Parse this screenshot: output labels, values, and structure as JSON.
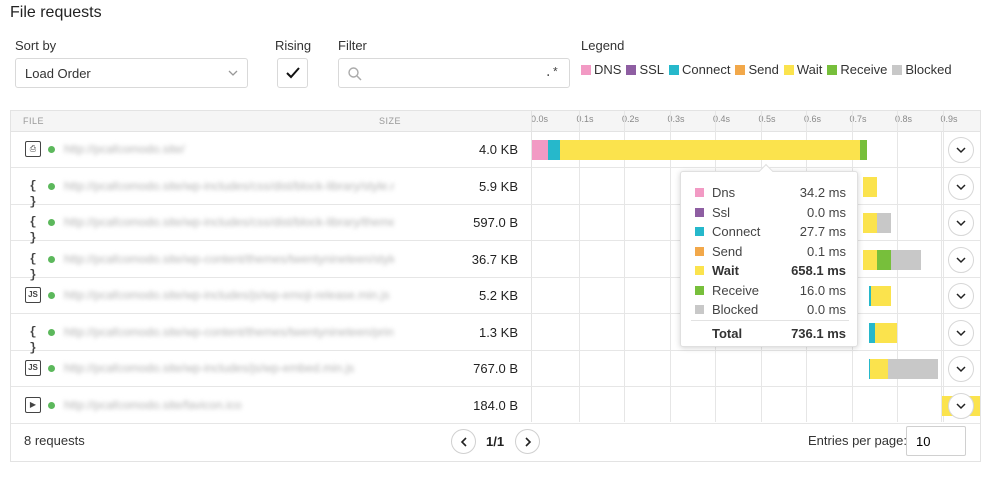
{
  "page": {
    "title": "File requests"
  },
  "controls": {
    "sort_label": "Sort by",
    "sort_value": "Load Order",
    "rising_label": "Rising",
    "filter_label": "Filter",
    "filter_value": "",
    "regex_toggle": ".*",
    "legend_label": "Legend"
  },
  "legend": [
    {
      "name": "DNS",
      "color": "#f29ac4"
    },
    {
      "name": "SSL",
      "color": "#8e5ea2"
    },
    {
      "name": "Connect",
      "color": "#26b8cb"
    },
    {
      "name": "Send",
      "color": "#f2a84a"
    },
    {
      "name": "Wait",
      "color": "#fbe34d"
    },
    {
      "name": "Receive",
      "color": "#77bf3b"
    },
    {
      "name": "Blocked",
      "color": "#c8c8c8"
    }
  ],
  "table": {
    "col_file": "FILE",
    "col_size": "SIZE",
    "ticks": [
      "0.0s",
      "0.1s",
      "0.2s",
      "0.3s",
      "0.4s",
      "0.5s",
      "0.6s",
      "0.7s",
      "0.8s",
      "0.9s"
    ],
    "rows": [
      {
        "icon": "html-file-icon",
        "icon_glyph": "⎙",
        "url": "http://pcafcomodo.site/",
        "size": "4.0 KB",
        "timings": {
          "start": 0.0,
          "dns": 0.0342,
          "ssl": 0.0,
          "connect": 0.0277,
          "send": 0.0001,
          "wait": 0.6581,
          "receive": 0.016,
          "blocked": 0.0
        }
      },
      {
        "icon": "css-file-icon",
        "icon_glyph": "{ }",
        "url": "http://pcafcomodo.site/wp-includes/css/dist/block-library/style.min.css",
        "size": "5.9 KB",
        "timings": {
          "start": 0.728,
          "dns": 0,
          "ssl": 0,
          "connect": 0,
          "send": 0,
          "wait": 0.03,
          "receive": 0,
          "blocked": 0
        }
      },
      {
        "icon": "css-file-icon",
        "icon_glyph": "{ }",
        "url": "http://pcafcomodo.site/wp-includes/css/dist/block-library/theme.min.css",
        "size": "597.0 B",
        "timings": {
          "start": 0.728,
          "dns": 0,
          "ssl": 0,
          "connect": 0,
          "send": 0,
          "wait": 0.03,
          "receive": 0,
          "blocked": 0.032
        }
      },
      {
        "icon": "css-file-icon",
        "icon_glyph": "{ }",
        "url": "http://pcafcomodo.site/wp-content/themes/twentynineteen/style.css",
        "size": "36.7 KB",
        "timings": {
          "start": 0.728,
          "dns": 0,
          "ssl": 0,
          "connect": 0,
          "send": 0,
          "wait": 0.03,
          "receive": 0.032,
          "blocked": 0.066
        }
      },
      {
        "icon": "js-file-icon",
        "icon_glyph": "JS",
        "url": "http://pcafcomodo.site/wp-includes/js/wp-emoji-release.min.js",
        "size": "5.2 KB",
        "timings": {
          "start": 0.74,
          "dns": 0,
          "ssl": 0,
          "connect": 0.005,
          "send": 0,
          "wait": 0.045,
          "receive": 0,
          "blocked": 0
        }
      },
      {
        "icon": "css-file-icon",
        "icon_glyph": "{ }",
        "url": "http://pcafcomodo.site/wp-content/themes/twentynineteen/print.css",
        "size": "1.3 KB",
        "timings": {
          "start": 0.74,
          "dns": 0,
          "ssl": 0,
          "connect": 0.013,
          "send": 0,
          "wait": 0.05,
          "receive": 0,
          "blocked": 0
        }
      },
      {
        "icon": "js-file-icon",
        "icon_glyph": "JS",
        "url": "http://pcafcomodo.site/wp-includes/js/wp-embed.min.js",
        "size": "767.0 B",
        "timings": {
          "start": 0.74,
          "dns": 0,
          "ssl": 0,
          "connect": 0.003,
          "send": 0,
          "wait": 0.04,
          "receive": 0,
          "blocked": 0.11
        }
      },
      {
        "icon": "media-file-icon",
        "icon_glyph": "▶",
        "url": "http://pcafcomodo.site/favicon.ico",
        "size": "184.0 B",
        "timings": {
          "start": 0.9,
          "dns": 0,
          "ssl": 0,
          "connect": 0,
          "send": 0,
          "wait": 0.1,
          "receive": 0,
          "blocked": 0
        }
      }
    ]
  },
  "tooltip": {
    "rows": [
      {
        "name": "Dns",
        "value": "34.2 ms",
        "color": "#f29ac4"
      },
      {
        "name": "Ssl",
        "value": "0.0 ms",
        "color": "#8e5ea2"
      },
      {
        "name": "Connect",
        "value": "27.7 ms",
        "color": "#26b8cb"
      },
      {
        "name": "Send",
        "value": "0.1 ms",
        "color": "#f2a84a"
      },
      {
        "name": "Wait",
        "value": "658.1 ms",
        "color": "#fbe34d",
        "bold": true
      },
      {
        "name": "Receive",
        "value": "16.0 ms",
        "color": "#77bf3b"
      },
      {
        "name": "Blocked",
        "value": "0.0 ms",
        "color": "#c8c8c8"
      }
    ],
    "total_label": "Total",
    "total_value": "736.1 ms"
  },
  "footer": {
    "requests": "8 requests",
    "page": "1/1",
    "entries_label": "Entries per page:",
    "entries_value": "10"
  }
}
